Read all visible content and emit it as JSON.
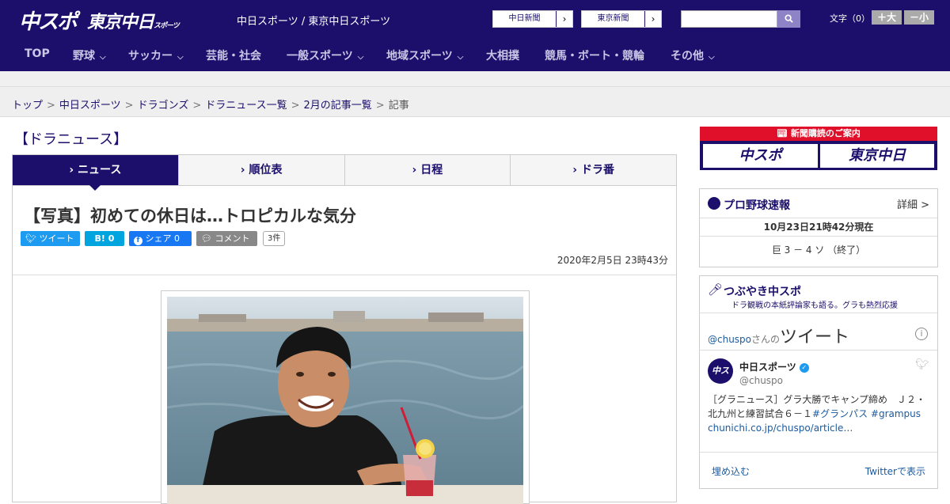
{
  "header": {
    "logo_main": "中スポ",
    "logo_tokyo": "東京中日",
    "logo_tokyo_small": "スポーツ",
    "site_name": "中日スポーツ / 東京中日スポーツ",
    "paper_links": [
      "中日新聞",
      "東京新聞"
    ],
    "search_placeholder": "",
    "font_size_label": "文字（0）",
    "font_bigger": "＋大",
    "font_smaller": "－小"
  },
  "nav": {
    "items": [
      {
        "label": "TOP",
        "has_dropdown": false
      },
      {
        "label": "野球",
        "has_dropdown": true
      },
      {
        "label": "サッカー",
        "has_dropdown": true
      },
      {
        "label": "芸能・社会",
        "has_dropdown": false
      },
      {
        "label": "一般スポーツ",
        "has_dropdown": true
      },
      {
        "label": "地域スポーツ",
        "has_dropdown": true
      },
      {
        "label": "大相撲",
        "has_dropdown": false
      },
      {
        "label": "競馬・ボート・競輪",
        "has_dropdown": false
      },
      {
        "label": "その他",
        "has_dropdown": true
      }
    ]
  },
  "breadcrumb": {
    "items": [
      "トップ",
      "中日スポーツ",
      "ドラゴンズ",
      "ドラニュース一覧",
      "2月の記事一覧"
    ],
    "current": "記事",
    "separator": ">"
  },
  "section": {
    "title": "【ドラニュース】",
    "tabs": [
      "ニュース",
      "順位表",
      "日程",
      "ドラ番"
    ]
  },
  "article": {
    "headline": "【写真】初めての休日は…トロピカルな気分",
    "share": {
      "tweet": "ツイート",
      "hatena": "B! 0",
      "facebook": "シェア 0",
      "comment": "コメント",
      "comment_count": "3件"
    },
    "datetime": "2020年2月5日 23時43分"
  },
  "sidebar": {
    "subscription": {
      "header": "新聞購読のご案内",
      "logo_left": "中スポ",
      "logo_right": "東京中日"
    },
    "baseball": {
      "title": "プロ野球速報",
      "detail": "詳細 >",
      "updated": "10月23日21時42分現在",
      "score": "巨 3 － 4 ソ （終了）"
    },
    "tweets": {
      "title": "つぶやき中スポ",
      "subtitle": "ドラ観戦の本紙評論家も語る。グラも熱烈応援",
      "account_prefix": "@chuspo",
      "account_suffix": "さんの",
      "heading": "ツイート",
      "user_name": "中日スポーツ",
      "user_handle": "@chuspo",
      "text_plain": "［グラニュース］グラ大勝でキャンプ締め　Ｊ２・北九州と練習試合６－１",
      "tag1": "#グランパス",
      "tag2": "#grampus",
      "link": "chunichi.co.jp/chuspo/article…",
      "embed": "埋め込む",
      "view_on_twitter": "Twitterで表示"
    }
  },
  "colors": {
    "brand_navy": "#1b0f6b",
    "accent_red": "#e0102a",
    "twitter_blue": "#1d9bf0",
    "facebook_blue": "#1877f2"
  }
}
